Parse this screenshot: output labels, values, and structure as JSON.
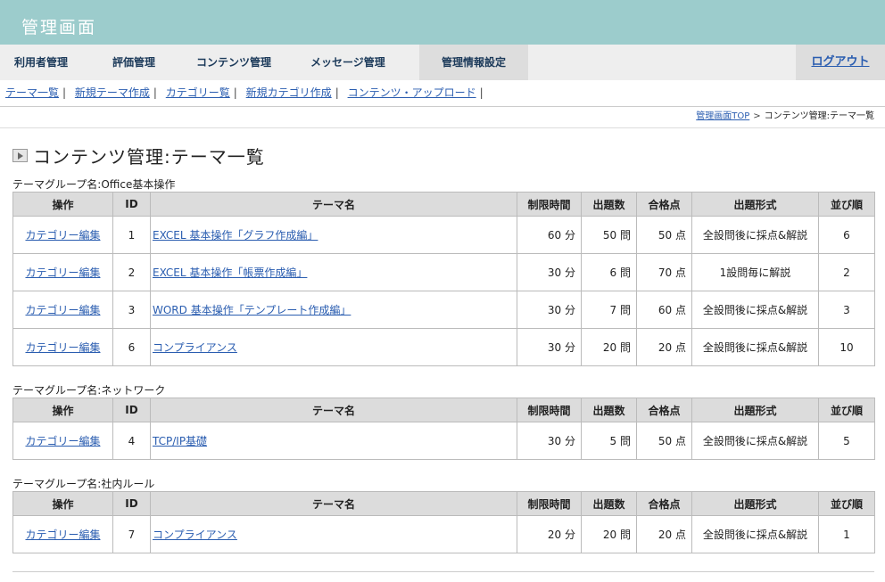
{
  "app": {
    "title": "管理画面"
  },
  "mainnav": {
    "items": [
      "利用者管理",
      "評価管理",
      "コンテンツ管理",
      "メッセージ管理",
      "管理情報設定"
    ],
    "logout": "ログアウト"
  },
  "subnav": {
    "links": [
      "テーマ一覧",
      "新規テーマ作成",
      "カテゴリー覧",
      "新規カテゴリ作成",
      "コンテンツ・アップロード"
    ],
    "separator": "|"
  },
  "breadcrumb": {
    "top": "管理画面TOP",
    "separator": ">",
    "current": "コンテンツ管理:テーマ一覧"
  },
  "page": {
    "title": "コンテンツ管理:テーマ一覧"
  },
  "columns": [
    "操作",
    "ID",
    "テーマ名",
    "制限時間",
    "出題数",
    "合格点",
    "出題形式",
    "並び順"
  ],
  "groups": [
    {
      "label": "テーマグループ名:Office基本操作",
      "rows": [
        {
          "action": "カテゴリー編集",
          "id": "1",
          "name": "EXCEL 基本操作「グラフ作成編」",
          "time": "60 分",
          "count": "50 問",
          "pass": "50 点",
          "format": "全設問後に採点&解説",
          "order": "6"
        },
        {
          "action": "カテゴリー編集",
          "id": "2",
          "name": "EXCEL 基本操作「帳票作成編」",
          "time": "30 分",
          "count": "6 問",
          "pass": "70 点",
          "format": "1設問毎に解説",
          "order": "2"
        },
        {
          "action": "カテゴリー編集",
          "id": "3",
          "name": "WORD 基本操作「テンプレート作成編」",
          "time": "30 分",
          "count": "7 問",
          "pass": "60 点",
          "format": "全設問後に採点&解説",
          "order": "3"
        },
        {
          "action": "カテゴリー編集",
          "id": "6",
          "name": "コンプライアンス",
          "time": "30 分",
          "count": "20 問",
          "pass": "20 点",
          "format": "全設問後に採点&解説",
          "order": "10"
        }
      ]
    },
    {
      "label": "テーマグループ名:ネットワーク",
      "rows": [
        {
          "action": "カテゴリー編集",
          "id": "4",
          "name": "TCP/IP基礎",
          "time": "30 分",
          "count": "5 問",
          "pass": "50 点",
          "format": "全設問後に採点&解説",
          "order": "5"
        }
      ]
    },
    {
      "label": "テーマグループ名:社内ルール",
      "rows": [
        {
          "action": "カテゴリー編集",
          "id": "7",
          "name": "コンプライアンス",
          "time": "20 分",
          "count": "20 問",
          "pass": "20 点",
          "format": "全設問後に採点&解説",
          "order": "1"
        }
      ]
    }
  ]
}
